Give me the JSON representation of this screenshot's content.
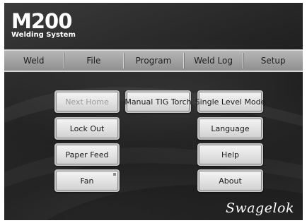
{
  "logo": {
    "title": "M200",
    "subtitle": "Welding System"
  },
  "menu": [
    {
      "label": "Weld"
    },
    {
      "label": "File"
    },
    {
      "label": "Program"
    },
    {
      "label": "Weld Log"
    },
    {
      "label": "Setup"
    }
  ],
  "buttons": {
    "next_home": "Next Home",
    "manual_tig_torch": "Manual TIG Torch",
    "single_level_mode": "Single Level Mode",
    "lock_out": "Lock Out",
    "language": "Language",
    "paper_feed": "Paper Feed",
    "help": "Help",
    "fan": "Fan",
    "about": "About"
  },
  "brand": "Swagelok",
  "colors": {
    "background": "#262626",
    "menubar": "#a3a3a3",
    "button_face": "#e2e2e2",
    "disabled_text": "#9a9a9a"
  }
}
